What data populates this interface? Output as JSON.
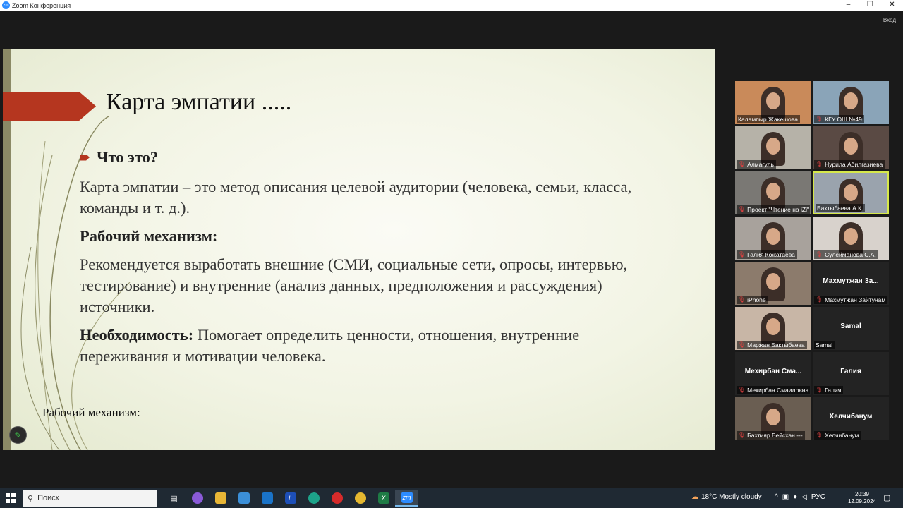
{
  "window": {
    "title": "Zoom Конференция",
    "minimize": "–",
    "maximize": "❐",
    "close": "✕"
  },
  "zoom": {
    "sign_in": "Вход"
  },
  "slide": {
    "title": "Карта эмпатии .....",
    "bullet_heading": "Что это?",
    "definition": "Карта эмпатии – это метод описания целевой аудитории (человека, семьи, класса, команды и т. д.).",
    "mechanism_heading": "Рабочий механизм:",
    "mechanism_text": "Рекомендуется выработать внешние (СМИ, социальные сети, опросы, интервью, тестирование) и внутренние (анализ данных, предположения и рассуждения) источники.",
    "need_heading": "Необходимость:",
    "need_text": " Помогает определить ценности, отношения, внутренние переживания и мотивации человека.",
    "footnote": "Рабочий механизм:",
    "accent_color": "#b5361f"
  },
  "participants": [
    {
      "name": "Калампыр Жакешова",
      "video": true,
      "bg": "#c98a5a",
      "muted": false
    },
    {
      "name": "КГУ ОШ №49",
      "video": true,
      "bg": "#8aa4b8",
      "muted": true
    },
    {
      "name": "Алмагуль",
      "video": true,
      "bg": "#b6b2a8",
      "muted": true
    },
    {
      "name": "Нурила Абилгазиева",
      "video": true,
      "bg": "#5a4a44",
      "muted": true
    },
    {
      "name": "Проект \"Чтение на iZi\"",
      "video": true,
      "bg": "#7a7874",
      "muted": true
    },
    {
      "name": "Бахтыбаева А.К.",
      "video": true,
      "bg": "#9aa3ad",
      "muted": false,
      "active": true
    },
    {
      "name": "Галия Кожатаева",
      "video": true,
      "bg": "#a8a29c",
      "muted": true
    },
    {
      "name": "Сулейманова С.А.",
      "video": true,
      "bg": "#d8d2cc",
      "muted": true
    },
    {
      "name": "iPhone",
      "video": true,
      "bg": "#8c7b6c",
      "muted": true
    },
    {
      "name": "Махмутжан Зайтунам",
      "video": false,
      "display": "Махмутжан  За...",
      "muted": true
    },
    {
      "name": "Маржан Бактыбаева",
      "video": true,
      "bg": "#c8b6a6",
      "muted": true
    },
    {
      "name": "Samal",
      "video": false,
      "display": "Samal",
      "muted": false
    },
    {
      "name": "Мехирбан Смаиловна",
      "video": false,
      "display": "Мехирбан  Сма...",
      "muted": true
    },
    {
      "name": "Галия",
      "video": false,
      "display": "Галия",
      "muted": true
    },
    {
      "name": "Бахтияр Бейсхан ---",
      "video": true,
      "bg": "#6a5e52",
      "muted": true
    },
    {
      "name": "Хелчибанум",
      "video": false,
      "display": "Хелчибанум",
      "muted": true
    }
  ],
  "taskbar": {
    "search_placeholder": "Поиск",
    "apps": [
      "task-view",
      "copilot",
      "file-explorer",
      "store",
      "mail",
      "lens",
      "edge",
      "opera",
      "chrome",
      "excel",
      "zoom"
    ],
    "weather": "18°C  Mostly cloudy",
    "language": "РУС",
    "time": "20:39",
    "date": "12.09.2024"
  }
}
